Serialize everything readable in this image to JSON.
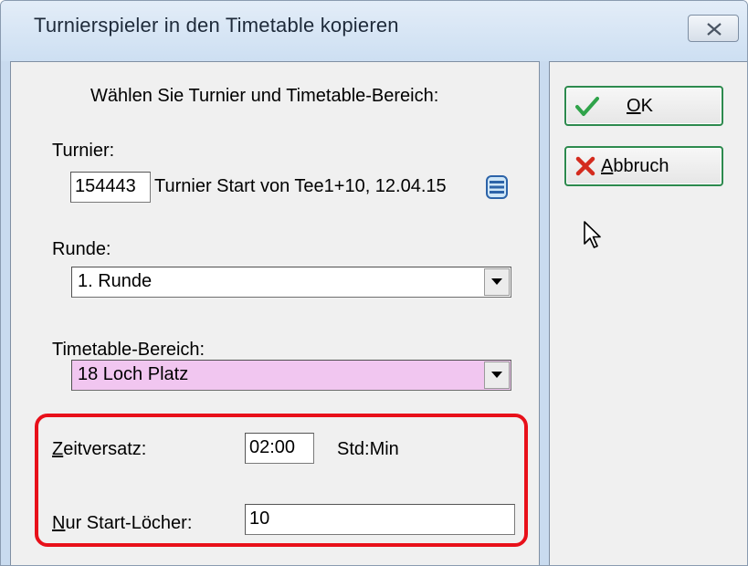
{
  "window": {
    "title": "Turnierspieler in den Timetable kopieren"
  },
  "form": {
    "instruction": "Wählen Sie Turnier und Timetable-Bereich:",
    "turnier": {
      "label": "Turnier:",
      "id": "154443",
      "description": "Turnier Start von Tee1+10, 12.04.15"
    },
    "runde": {
      "label": "Runde:",
      "selected": "1. Runde"
    },
    "timetable": {
      "label": "Timetable-Bereich:",
      "selected": "18 Loch Platz",
      "highlight_color": "#f1c6f0"
    },
    "zeitversatz": {
      "label_first": "Z",
      "label_rest": "eitversatz:",
      "value": "02:00",
      "unit": "Std:Min"
    },
    "start_loecher": {
      "label_first": "N",
      "label_rest": "ur Start-Löcher:",
      "value": "10"
    }
  },
  "buttons": {
    "ok": {
      "label_first": "O",
      "label_rest": "K"
    },
    "cancel": {
      "label_first": "A",
      "label_rest": "bbruch"
    }
  },
  "colors": {
    "annotation_border": "#e8101a",
    "button_border": "#2d8a4e",
    "ok_icon": "#2fa34a",
    "cancel_icon": "#d42b1e"
  },
  "icons": {
    "ok": "checkmark-icon",
    "cancel": "x-icon",
    "lookup": "list-lookup-icon",
    "close": "close-icon",
    "cursor": "mouse-pointer-icon"
  }
}
